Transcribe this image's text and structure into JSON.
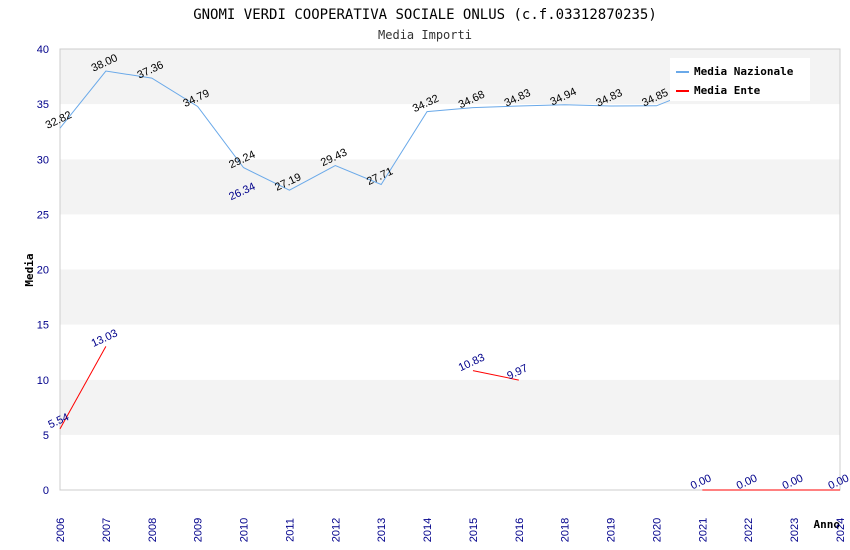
{
  "chart_data": {
    "type": "line",
    "title": "GNOMI VERDI COOPERATIVA SOCIALE ONLUS (c.f.03312870235)",
    "subtitle": "Media Importi",
    "xlabel": "Anno",
    "ylabel": "Media",
    "ylim": [
      0,
      40
    ],
    "yticks": [
      "0",
      "5",
      "10",
      "15",
      "20",
      "25",
      "30",
      "35",
      "40"
    ],
    "categories": [
      "2006",
      "2007",
      "2008",
      "2009",
      "2010",
      "2011",
      "2012",
      "2013",
      "2014",
      "2015",
      "2016",
      "2018",
      "2019",
      "2020",
      "2021",
      "2022",
      "2023",
      "2024"
    ],
    "legend_position": "top-right",
    "grid": true,
    "series": [
      {
        "name": "Media Nazionale",
        "color": "#6aa9e9",
        "values": [
          32.82,
          38.0,
          37.36,
          34.79,
          29.24,
          27.19,
          29.43,
          27.71,
          34.32,
          34.68,
          34.83,
          34.94,
          34.83,
          34.85,
          36.5,
          36.5,
          37.49,
          null
        ],
        "labels": [
          "32.82",
          "38.00",
          "37.36",
          "34.79",
          "29.24",
          "27.19",
          "29.43",
          "27.71",
          "34.32",
          "34.68",
          "34.83",
          "34.94",
          "34.83",
          "34.85",
          "",
          "",
          "37.49",
          ""
        ]
      },
      {
        "name": "Media Ente",
        "color": "#ff0000",
        "values": [
          5.54,
          13.03,
          null,
          null,
          26.34,
          null,
          null,
          null,
          null,
          10.83,
          9.97,
          null,
          null,
          null,
          0.0,
          0.0,
          0.0,
          0.0
        ],
        "labels": [
          "5.54",
          "13.03",
          "",
          "",
          "26.34",
          "",
          "",
          "",
          "",
          "10.83",
          "9.97",
          "",
          "",
          "",
          "0.00",
          "0.00",
          "0.00",
          "0.00"
        ]
      }
    ]
  }
}
